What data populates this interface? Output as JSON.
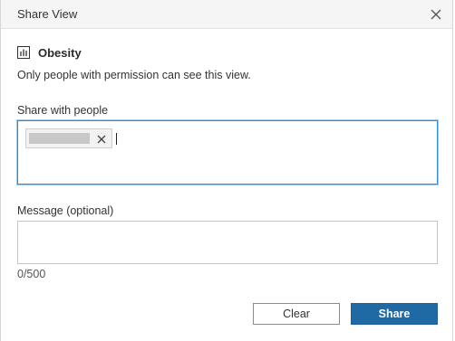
{
  "dialog": {
    "title": "Share View",
    "close_icon": "close-icon"
  },
  "view": {
    "icon": "bar-chart-icon",
    "name": "Obesity"
  },
  "permission_note": "Only people with permission can see this view.",
  "share_with": {
    "label": "Share with people",
    "chip": {
      "remove_icon": "close-icon"
    }
  },
  "message": {
    "label": "Message (optional)",
    "value": "",
    "char_count": "0/500"
  },
  "buttons": {
    "clear_label": "Clear",
    "share_label": "Share"
  },
  "colors": {
    "header_bg": "#f5f5f5",
    "focus_border": "#2d8fd5",
    "primary_button": "#1f6aa5"
  }
}
